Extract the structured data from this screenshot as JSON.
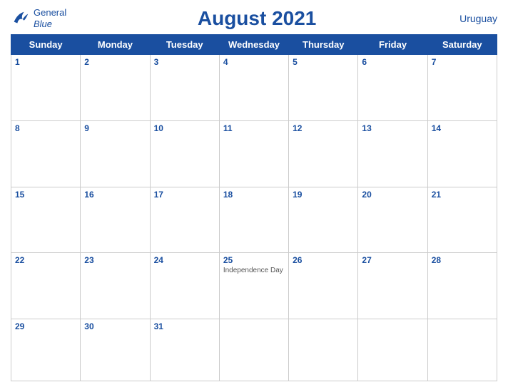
{
  "header": {
    "logo_line1": "General",
    "logo_line2": "Blue",
    "title": "August 2021",
    "country": "Uruguay"
  },
  "weekdays": [
    "Sunday",
    "Monday",
    "Tuesday",
    "Wednesday",
    "Thursday",
    "Friday",
    "Saturday"
  ],
  "weeks": [
    [
      {
        "date": 1,
        "header": true,
        "events": []
      },
      {
        "date": 2,
        "header": true,
        "events": []
      },
      {
        "date": 3,
        "header": true,
        "events": []
      },
      {
        "date": 4,
        "header": true,
        "events": []
      },
      {
        "date": 5,
        "header": true,
        "events": []
      },
      {
        "date": 6,
        "header": true,
        "events": []
      },
      {
        "date": 7,
        "header": true,
        "events": []
      }
    ],
    [
      {
        "date": 8,
        "header": true,
        "events": []
      },
      {
        "date": 9,
        "header": true,
        "events": []
      },
      {
        "date": 10,
        "header": true,
        "events": []
      },
      {
        "date": 11,
        "header": true,
        "events": []
      },
      {
        "date": 12,
        "header": true,
        "events": []
      },
      {
        "date": 13,
        "header": true,
        "events": []
      },
      {
        "date": 14,
        "header": true,
        "events": []
      }
    ],
    [
      {
        "date": 15,
        "header": true,
        "events": []
      },
      {
        "date": 16,
        "header": true,
        "events": []
      },
      {
        "date": 17,
        "header": true,
        "events": []
      },
      {
        "date": 18,
        "header": true,
        "events": []
      },
      {
        "date": 19,
        "header": true,
        "events": []
      },
      {
        "date": 20,
        "header": true,
        "events": []
      },
      {
        "date": 21,
        "header": true,
        "events": []
      }
    ],
    [
      {
        "date": 22,
        "header": true,
        "events": []
      },
      {
        "date": 23,
        "header": true,
        "events": []
      },
      {
        "date": 24,
        "header": true,
        "events": []
      },
      {
        "date": 25,
        "header": true,
        "events": [
          "Independence Day"
        ]
      },
      {
        "date": 26,
        "header": true,
        "events": []
      },
      {
        "date": 27,
        "header": true,
        "events": []
      },
      {
        "date": 28,
        "header": true,
        "events": []
      }
    ],
    [
      {
        "date": 29,
        "header": true,
        "events": []
      },
      {
        "date": 30,
        "header": true,
        "events": []
      },
      {
        "date": 31,
        "header": true,
        "events": []
      },
      {
        "date": null,
        "header": false,
        "events": []
      },
      {
        "date": null,
        "header": false,
        "events": []
      },
      {
        "date": null,
        "header": false,
        "events": []
      },
      {
        "date": null,
        "header": false,
        "events": []
      }
    ]
  ],
  "colors": {
    "header_bg": "#1a4fa0",
    "header_text": "#ffffff",
    "day_number": "#1a4fa0",
    "border": "#cccccc",
    "event_text": "#555555"
  }
}
